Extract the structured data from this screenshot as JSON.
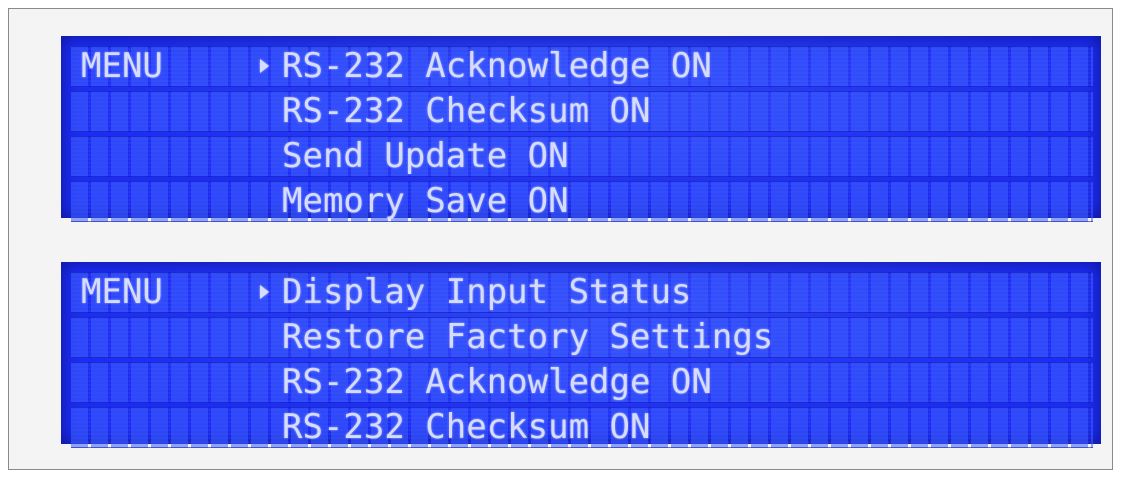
{
  "displays": [
    {
      "menu_label": "MENU",
      "selected_index": 0,
      "items": [
        "RS-232 Acknowledge ON",
        "RS-232 Checksum ON",
        "Send Update ON",
        "Memory Save ON"
      ]
    },
    {
      "menu_label": "MENU",
      "selected_index": 0,
      "items": [
        "Display Input Status",
        "Restore Factory Settings",
        "RS-232 Acknowledge ON",
        "RS-232 Checksum ON"
      ]
    }
  ],
  "colors": {
    "lcd_background": "#1c2cf4",
    "lcd_text": "#d6dcff",
    "frame_background": "#f4f4f4"
  },
  "icons": {
    "selection_cursor": "triangle-right-icon"
  }
}
